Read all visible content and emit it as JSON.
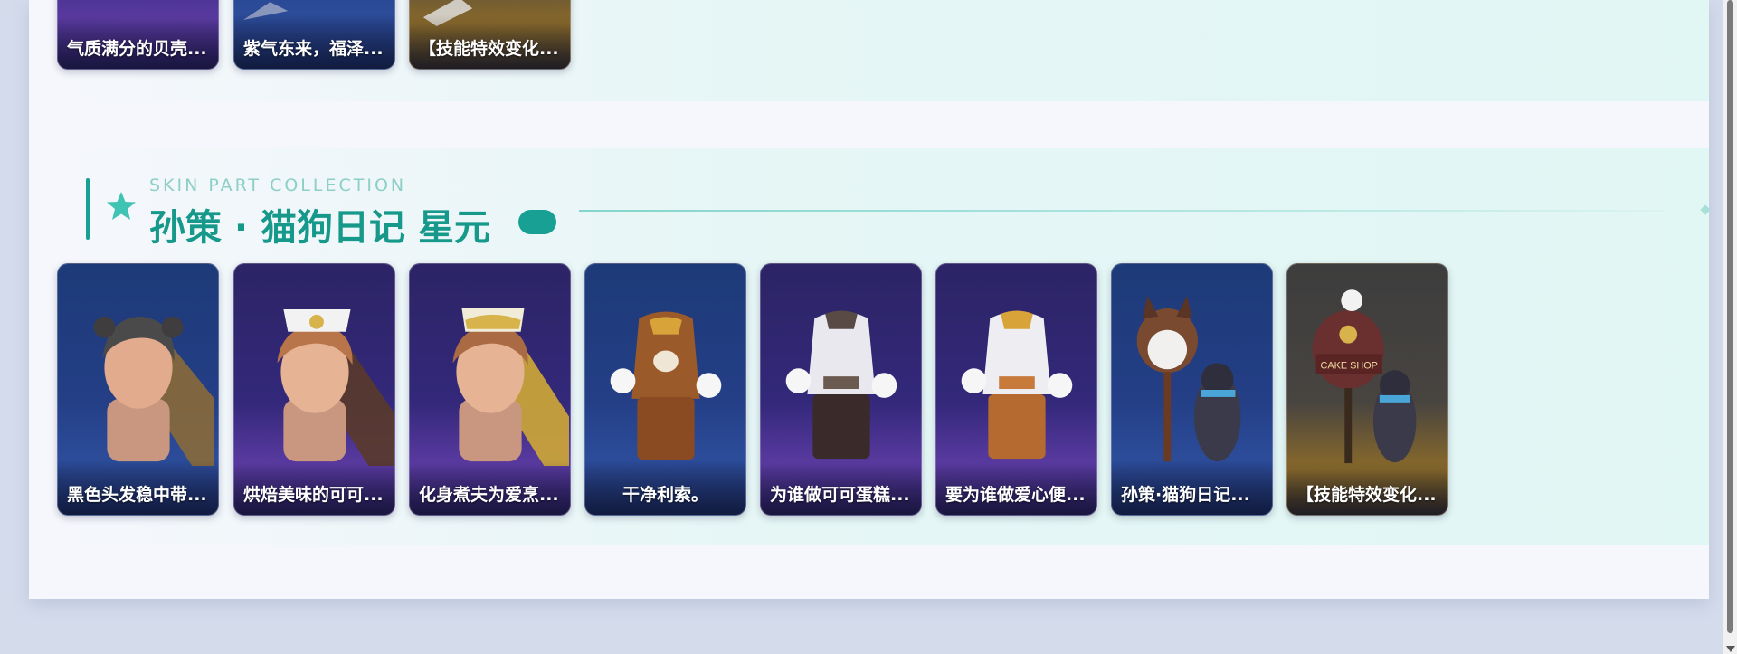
{
  "previous_section": {
    "items": [
      {
        "label": "气质满分的贝壳...",
        "bg": "purple"
      },
      {
        "label": "紫气东来，福泽...",
        "bg": "navy"
      },
      {
        "label": "【技能特效变化...",
        "bg": "brown"
      }
    ]
  },
  "section": {
    "subtitle": "SKIN PART COLLECTION",
    "title": "孙策 · 猫狗日记 星元",
    "icon": "star-icon",
    "accent_color": "#17a093",
    "items": [
      {
        "label": "黑色头发稳中带...",
        "bg": "navy",
        "art": "head-ears"
      },
      {
        "label": "烘焙美味的可可...",
        "bg": "purple",
        "art": "head-chef-hat"
      },
      {
        "label": "化身煮夫为爱烹...",
        "bg": "purple",
        "art": "head-chef-hat-gold"
      },
      {
        "label": "干净利索。",
        "bg": "navy",
        "art": "outfit-brown"
      },
      {
        "label": "为谁做可可蛋糕...",
        "bg": "purple",
        "art": "outfit-white-dark"
      },
      {
        "label": "要为谁做爱心便...",
        "bg": "purple",
        "art": "outfit-white-orange"
      },
      {
        "label": "孙策·猫狗日记...",
        "bg": "navy",
        "art": "dogs"
      },
      {
        "label": "【技能特效变化...",
        "bg": "brown",
        "art": "cake-shop-dog"
      }
    ]
  }
}
